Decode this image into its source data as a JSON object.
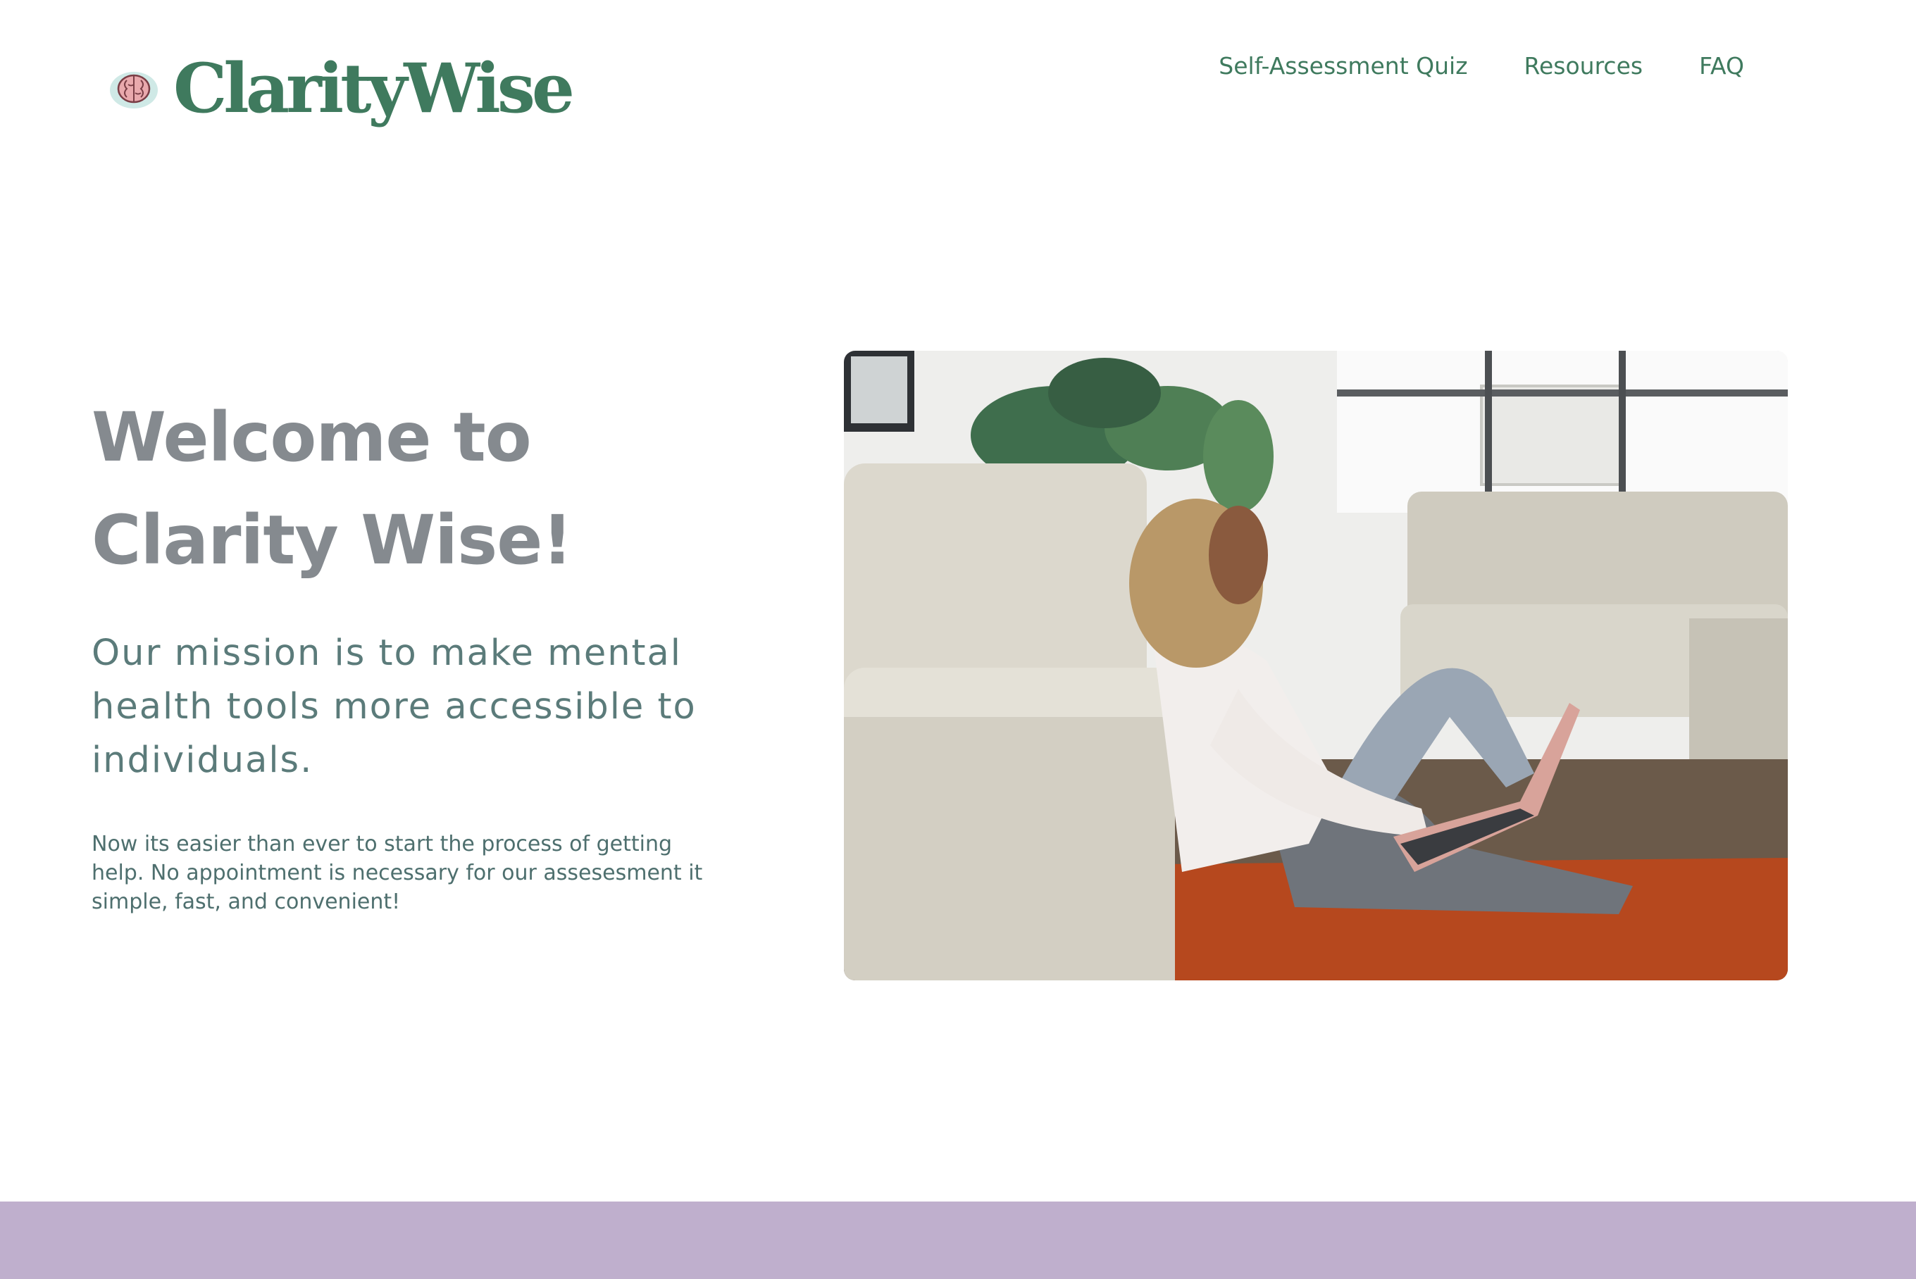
{
  "header": {
    "logo_text": "ClarityWise",
    "logo_icon": "brain-icon",
    "nav": [
      {
        "label": "Self-Assessment Quiz"
      },
      {
        "label": "Resources"
      },
      {
        "label": "FAQ"
      }
    ]
  },
  "hero": {
    "title_line1": "Welcome to",
    "title_line2": "Clarity Wise!",
    "mission": "Our mission is to make mental health tools more accessible to individuals.",
    "description": "Now its easier than ever to start the process of getting help. No appointment is necessary for our assesesment it simple, fast, and convenient!",
    "image_subject": "woman-with-laptop-photo"
  },
  "colors": {
    "brand_green": "#3f7a5e",
    "title_gray": "#858a8f",
    "text_teal": "#5b7b7a",
    "footer_purple": "#bfafcd"
  }
}
